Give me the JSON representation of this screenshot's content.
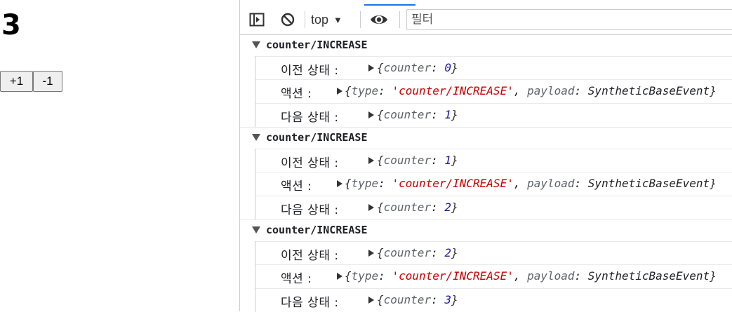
{
  "app": {
    "count": "3",
    "increment_label": "+1",
    "decrement_label": "-1"
  },
  "devtools": {
    "context": "top",
    "filter_placeholder": "필터"
  },
  "log_groups": [
    {
      "title": "counter/INCREASE",
      "prev_label": "이전 상태 :",
      "action_label": "액션 :",
      "next_label": "다음 상태 :",
      "prev_key": "counter",
      "prev_value": "0",
      "action_type_key": "type",
      "action_type_value": "'counter/INCREASE'",
      "action_payload_key": "payload",
      "action_payload_value": "SyntheticBaseEvent",
      "next_key": "counter",
      "next_value": "1"
    },
    {
      "title": "counter/INCREASE",
      "prev_label": "이전 상태 :",
      "action_label": "액션 :",
      "next_label": "다음 상태 :",
      "prev_key": "counter",
      "prev_value": "1",
      "action_type_key": "type",
      "action_type_value": "'counter/INCREASE'",
      "action_payload_key": "payload",
      "action_payload_value": "SyntheticBaseEvent",
      "next_key": "counter",
      "next_value": "2"
    },
    {
      "title": "counter/INCREASE",
      "prev_label": "이전 상태 :",
      "action_label": "액션 :",
      "next_label": "다음 상태 :",
      "prev_key": "counter",
      "prev_value": "2",
      "action_type_key": "type",
      "action_type_value": "'counter/INCREASE'",
      "action_payload_key": "payload",
      "action_payload_value": "SyntheticBaseEvent",
      "next_key": "counter",
      "next_value": "3"
    }
  ],
  "colors": {
    "accent": "#1a73e8",
    "string": "#c80000",
    "number": "#1a1aa6"
  }
}
